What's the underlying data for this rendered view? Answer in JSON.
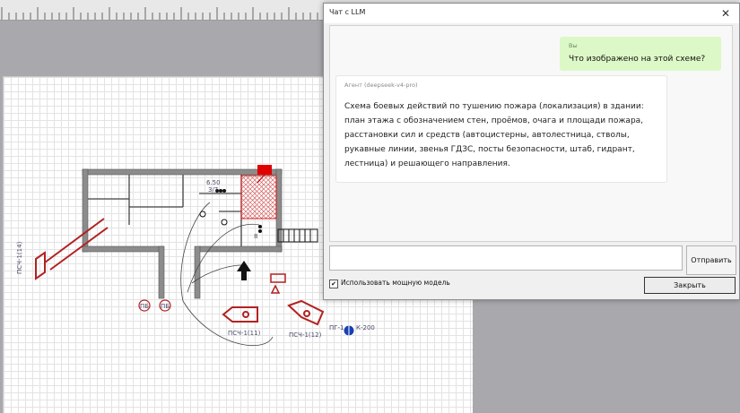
{
  "dialog": {
    "title": "Чат с LLM",
    "close_glyph": "✕",
    "user_sender": "Вы",
    "user_message": "Что изображено на этой схеме?",
    "agent_sender": "Агент (deepseek-v4-pro)",
    "agent_message": "Схема боевых действий по тушению пожара (локализация) в здании: план этажа с обозначением стен, проёмов, очага и площади пожара, расстановки сил и средств (автоцистерны, автолестница, стволы, рукавные линии, звенья ГДЗС, посты безопасности, штаб, гидрант, лестница) и решающего направления.",
    "input_value": "",
    "send_label": "Отправить",
    "checkbox_label": "Использовать мощную модель",
    "checkbox_checked": "✔",
    "close_label": "Закрыть"
  },
  "scheme": {
    "labels": {
      "ladder_truck": "ПСЧ-1(14)",
      "tanker1": "ПСЧ-1(11)",
      "tanker2": "ПСЧ-1(12)",
      "hydrant": "ПГ-1",
      "hydrant_size": "К-200",
      "pos_upper": "6.50",
      "pos_upper_sub": "3/7",
      "pos_right": "8",
      "circle1": "ПБ",
      "circle2": "ПБ"
    },
    "colors": {
      "walls": "#8c8c8c",
      "fire": "#cc1a1a",
      "units": "#b22222",
      "hydrant": "#1a3fb0"
    }
  }
}
